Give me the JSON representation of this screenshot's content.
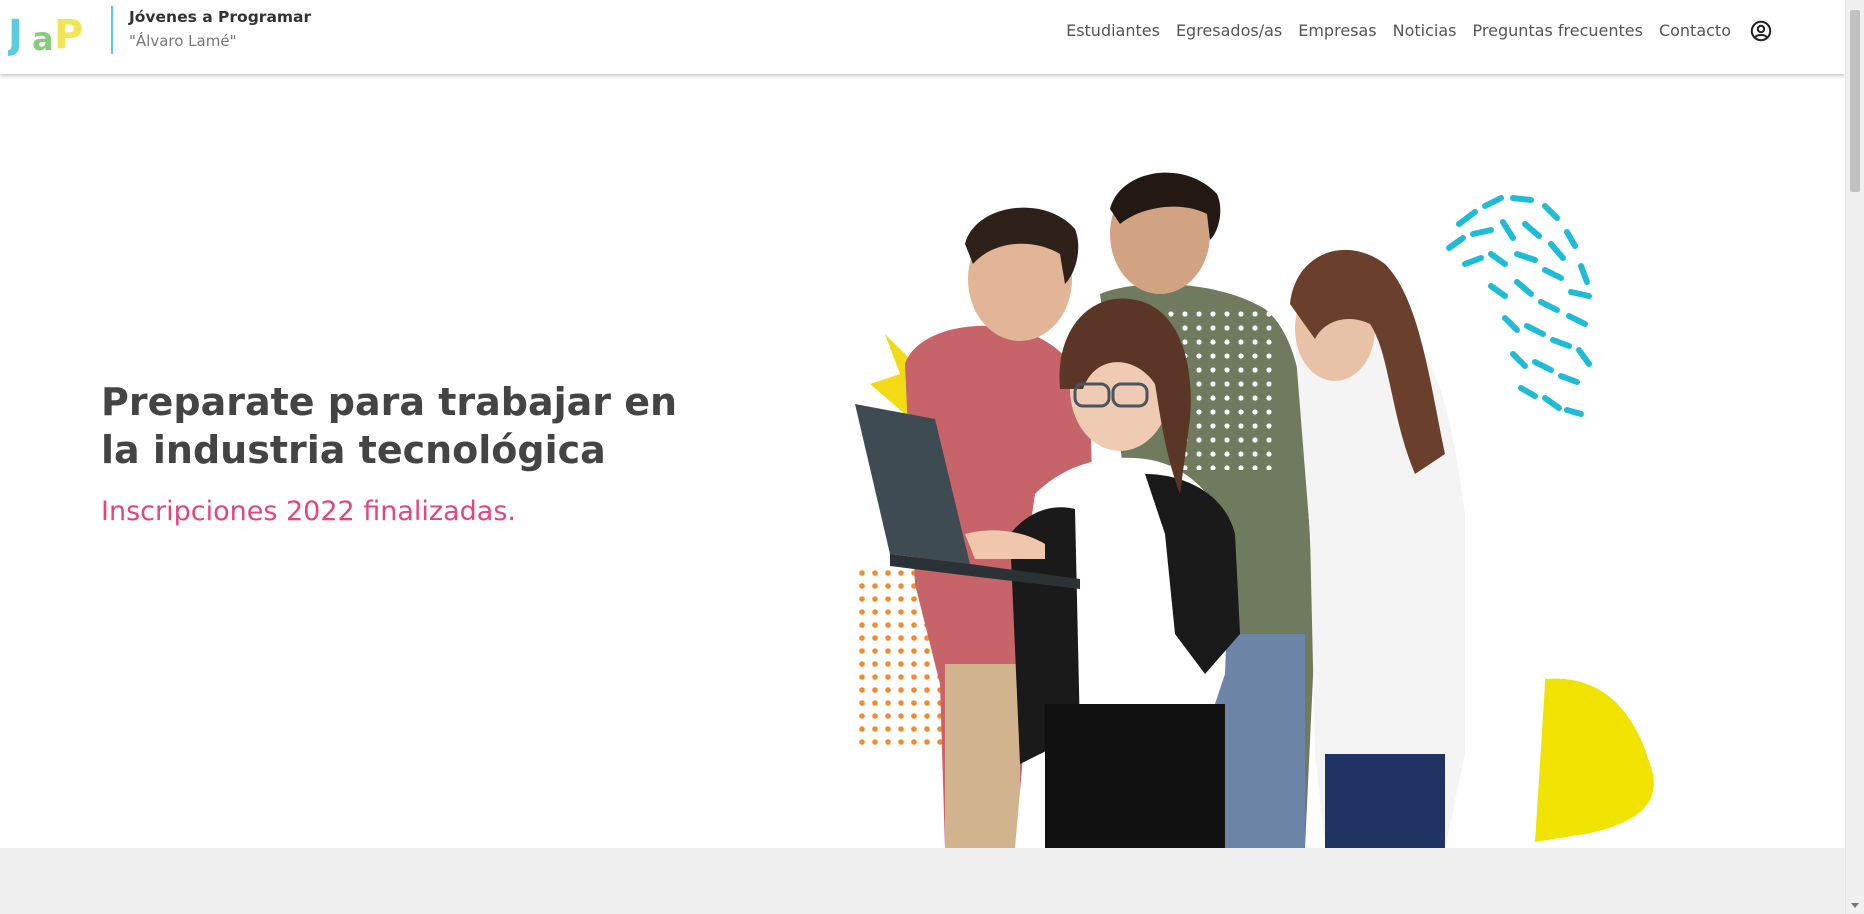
{
  "brand": {
    "logo_text": "JaP",
    "title": "Jóvenes a Programar",
    "subtitle": "\"Álvaro Lamé\""
  },
  "nav": {
    "items": [
      {
        "label": "Estudiantes"
      },
      {
        "label": "Egresados/as"
      },
      {
        "label": "Empresas"
      },
      {
        "label": "Noticias"
      },
      {
        "label": "Preguntas frecuentes"
      },
      {
        "label": "Contacto"
      }
    ],
    "user_icon": "user-circle-icon"
  },
  "hero": {
    "title": "Preparate para trabajar en la industria tecnológica",
    "subtitle": "Inscripciones 2022 finalizadas.",
    "image": "students-with-laptop-photo"
  },
  "colors": {
    "accent_pink": "#e2457f",
    "accent_cyan": "#1fbcd8",
    "accent_yellow": "#f1e300",
    "accent_orange": "#f28a2e",
    "text_dark": "#444444"
  }
}
